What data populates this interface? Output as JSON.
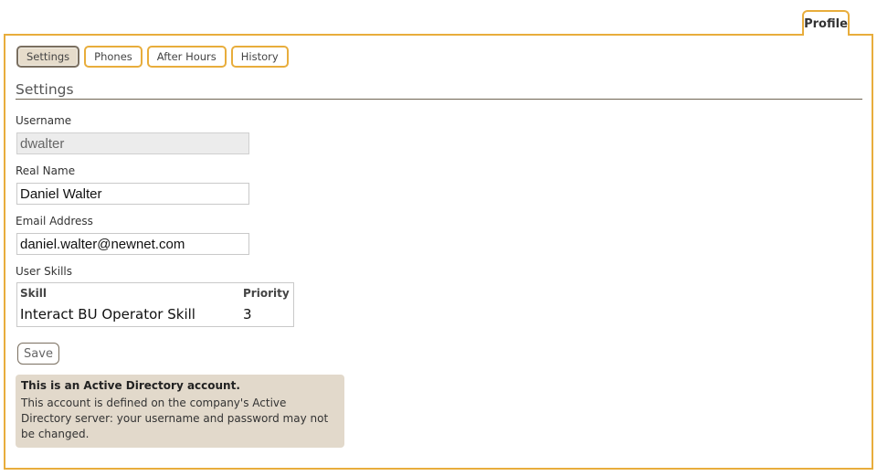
{
  "tabs": {
    "profile_label": "Profile"
  },
  "subtabs": [
    {
      "label": "Settings",
      "active": true
    },
    {
      "label": "Phones",
      "active": false
    },
    {
      "label": "After Hours",
      "active": false
    },
    {
      "label": "History",
      "active": false
    }
  ],
  "section": {
    "title": "Settings"
  },
  "fields": {
    "username": {
      "label": "Username",
      "value": "dwalter",
      "disabled": true
    },
    "real_name": {
      "label": "Real Name",
      "value": "Daniel Walter"
    },
    "email": {
      "label": "Email Address",
      "value": "daniel.walter@newnet.com"
    }
  },
  "skills": {
    "label": "User Skills",
    "headers": {
      "skill": "Skill",
      "priority": "Priority"
    },
    "rows": [
      {
        "skill": "Interact BU Operator Skill",
        "priority": "3"
      }
    ]
  },
  "save_label": "Save",
  "notice": {
    "title": "This is an Active Directory account.",
    "body": "This account is defined on the company's Active Directory server: your username and password may not be changed."
  },
  "colors": {
    "accent": "#e8ad3c",
    "notice_bg": "#e2d9cb",
    "rule": "#6f6452"
  }
}
